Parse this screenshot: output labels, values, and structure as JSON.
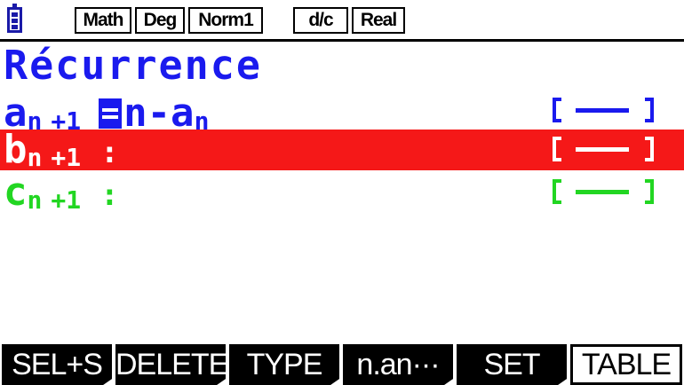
{
  "status_bar": {
    "battery_icon": "battery-full-icon",
    "indicators": [
      "Math",
      "Deg",
      "Norm1",
      "d/c",
      "Real"
    ]
  },
  "editor": {
    "title": "Récurrence",
    "rows": [
      {
        "letter": "a",
        "subscript": "n",
        "index": "+1",
        "expr_text": "n-a",
        "expr_sub": "n",
        "color": "#1a1aee",
        "selected": false,
        "has_cursor": true
      },
      {
        "letter": "b",
        "subscript": "n",
        "index": "+1",
        "separator": ":",
        "color": "#ffffff",
        "selected": true,
        "highlight_color": "#f51818"
      },
      {
        "letter": "c",
        "subscript": "n",
        "index": "+1",
        "separator": ":",
        "color": "#22d622",
        "selected": false
      }
    ]
  },
  "function_keys": [
    {
      "label": "SEL+S"
    },
    {
      "label": "DELETE"
    },
    {
      "label": "TYPE"
    },
    {
      "label": "n.an···"
    },
    {
      "label": "SET"
    },
    {
      "label": "TABLE",
      "boxed": true
    }
  ]
}
